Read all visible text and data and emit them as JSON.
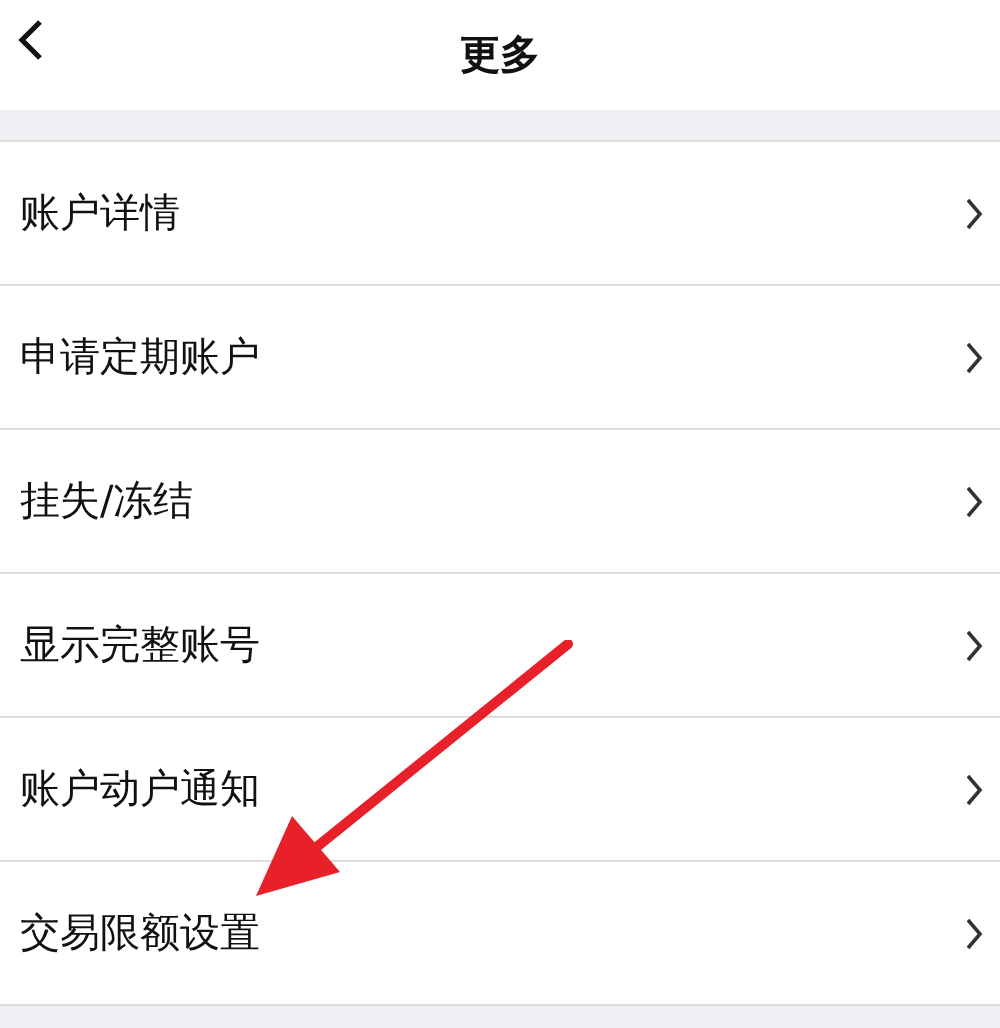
{
  "header": {
    "title": "更多"
  },
  "menu_items": [
    {
      "label": "账户详情"
    },
    {
      "label": "申请定期账户"
    },
    {
      "label": "挂失/冻结"
    },
    {
      "label": "显示完整账号"
    },
    {
      "label": "账户动户通知"
    },
    {
      "label": "交易限额设置"
    }
  ],
  "annotation": {
    "kind": "arrow"
  }
}
